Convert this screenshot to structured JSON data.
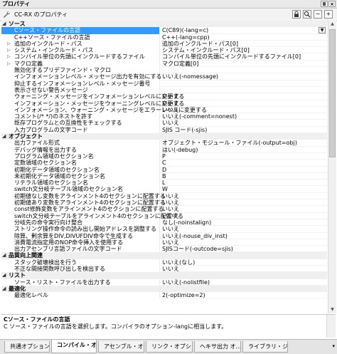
{
  "window": {
    "title": "プロパティ",
    "pin_label": "Ⅱ",
    "close_label": "×"
  },
  "header": {
    "project": "CC-RX のプロパティ",
    "btn_lock": "🔒",
    "btn_search": "🔎",
    "btn_minus": "−",
    "btn_plus": "+"
  },
  "rows": [
    {
      "type": "cat",
      "expanded": true,
      "key": "ソース"
    },
    {
      "key": "Cソース・ファイルの言語",
      "value": "C(C89)(-lang=c)",
      "selected": true,
      "dropdown": true
    },
    {
      "key": "C++ソース・ファイルの言語",
      "value": "C++(-lang=cpp)"
    },
    {
      "key": "追加のインクルード・パス",
      "value": "追加のインクルード・パス[0]",
      "expandable": true
    },
    {
      "key": "システム・インクルード・パス",
      "value": "システム・インクルード・パス[0]",
      "expandable": true
    },
    {
      "key": "コンパイル単位の先頭にインクルードするファイル",
      "value": "コンパイル単位の先頭にインクルードするファイル[0]",
      "expandable": true
    },
    {
      "key": "マクロ定義",
      "value": "マクロ定義[0]",
      "expandable": true
    },
    {
      "key": "無効化するプリデファインド・マクロ",
      "value": ""
    },
    {
      "key": "インフォメーションレベル・メッセージ出力を有効にする",
      "value": "いいえ(-nomessage)"
    },
    {
      "key": "抑止するインフォメーションレベル・メッセージ番号",
      "value": ""
    },
    {
      "key": "表示させない警告メッセージ",
      "value": ""
    },
    {
      "key": "ウォーニング・メッセージをインフォメーションレベルに変更する",
      "value": "いいえ"
    },
    {
      "key": "インフォメーション・メッセージをウォーニングレベルに変更する",
      "value": "いいえ"
    },
    {
      "key": "インフォメーション、ウォーニング・メッセージをエラーレベルに変更する",
      "value": "いいえ"
    },
    {
      "key": "コメント(/* */)のネストを許す",
      "value": "いいえ(-comment=nonest)"
    },
    {
      "key": "既存プログラムとの互換性をチェックする",
      "value": "いいえ"
    },
    {
      "key": "入力プログラムの文字コード",
      "value": "SJIS コード(-sjis)"
    },
    {
      "type": "cat",
      "expanded": true,
      "key": "オブジェクト"
    },
    {
      "key": "出力ファイル形式",
      "value": "オブジェクト・モジュール・ファイル(-output=obj)"
    },
    {
      "key": "デバッグ情報を出力する",
      "value": "はい(-debug)"
    },
    {
      "key": "プログラム領域のセクション名",
      "value": "P"
    },
    {
      "key": "定数領域のセクション名",
      "value": "C"
    },
    {
      "key": "初期化データ領域のセクション名",
      "value": "D"
    },
    {
      "key": "未初期化データ領域のセクション名",
      "value": "B"
    },
    {
      "key": "リテラル領域のセクション名",
      "value": "L"
    },
    {
      "key": "switch文分岐テーブル領域のセクション名",
      "value": "W"
    },
    {
      "key": "初期値なし変数をアラインメント4のセクションに配置する",
      "value": "いいえ"
    },
    {
      "key": "初期値あり変数をアラインメント4のセクションに配置する",
      "value": "いいえ"
    },
    {
      "key": "const修飾変数をアラインメント4のセクションに配置する",
      "value": "いいえ"
    },
    {
      "key": "switch文分岐テーブルをアラインメント4のセクションに配置する",
      "value": "いいえ"
    },
    {
      "key": "分岐先の命令実行向け整合",
      "value": "なし(-noinstalign)"
    },
    {
      "key": "ストリング操作命令の読み出し開始アドレスを調整する",
      "value": "いいえ"
    },
    {
      "key": "除算、剰余算をDIV,DIVUFDIV命令で生成する",
      "value": "いいえ(-nouse_div_inst)"
    },
    {
      "key": "消費電流指定用のNOP命令挿入を使用する",
      "value": "いいえ"
    },
    {
      "key": "出力アセンブリ言語ファイルの文字コード",
      "value": "SJISコード(-outcode=sjis)"
    },
    {
      "type": "cat",
      "expanded": true,
      "key": "品質向上関連"
    },
    {
      "key": "スタック破壊検出を行う",
      "value": "いいえ(なし)"
    },
    {
      "key": "不正な間接関数呼び出しを検出する",
      "value": "いいえ"
    },
    {
      "type": "cat",
      "expanded": true,
      "key": "リスト"
    },
    {
      "key": "ソース・リスト・ファイルを出力する",
      "value": "いいえ(-nolistfile)"
    },
    {
      "type": "cat",
      "expanded": true,
      "key": "最適化"
    },
    {
      "key": "最適化レベル",
      "value": "2(-optimize=2)"
    }
  ],
  "description": {
    "title": "Cソース・ファイルの言語",
    "body": "C ソース・ファイルの言語を選択します。コンパイラのオプション-langに相当します。"
  },
  "tabs": [
    {
      "label": "共通オプション",
      "active": false
    },
    {
      "label": "コンパイル・オ...",
      "active": true
    },
    {
      "label": "アセンブル・オ...",
      "active": false
    },
    {
      "label": "リンク・オプション",
      "active": false
    },
    {
      "label": "ヘキサ出力 オ...",
      "active": false
    },
    {
      "label": "ライブラリ・ジェ...",
      "active": false
    }
  ],
  "tab_menu": "▾",
  "icons": {
    "expand_collapsed": "▷",
    "expand_open": "◢",
    "dropdown": "▼",
    "scroll_up": "▲",
    "scroll_down": "▼"
  },
  "colors": {
    "selection": "#3399ff",
    "category_bg": "#efefef"
  }
}
